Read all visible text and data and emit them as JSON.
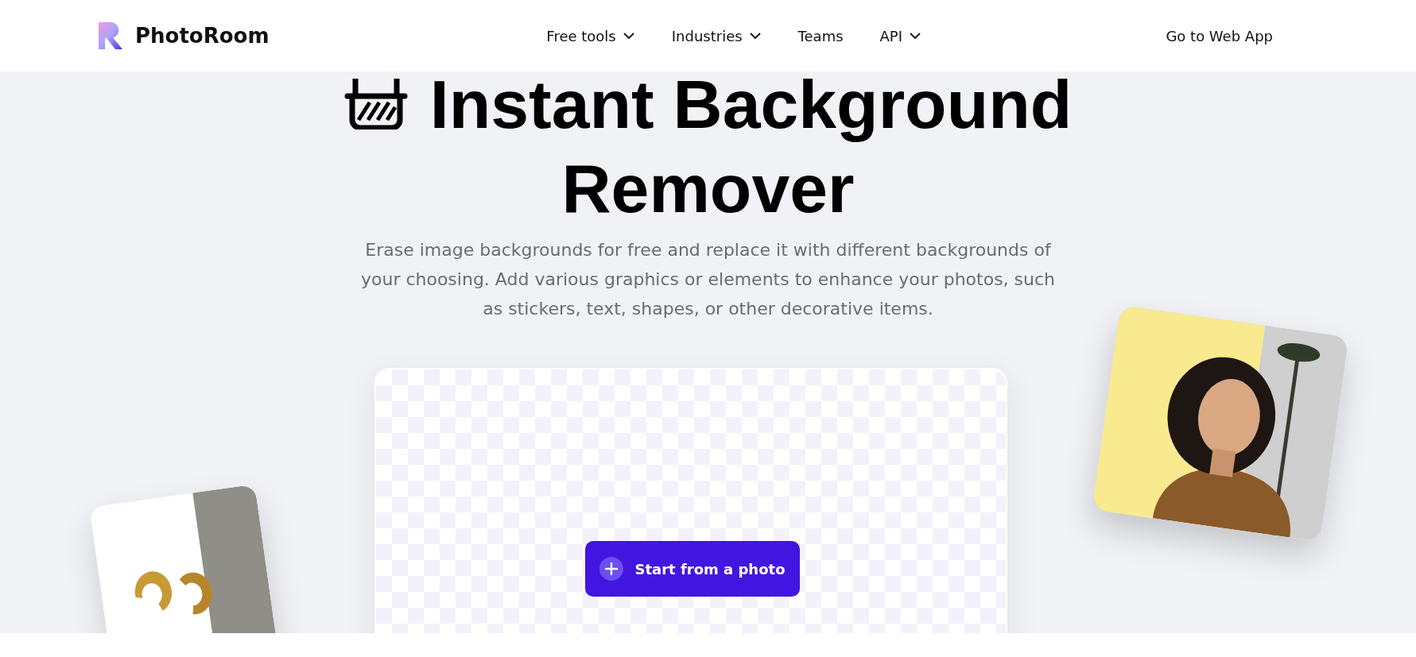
{
  "header": {
    "brand": "PhotoRoom",
    "nav": [
      {
        "label": "Free tools",
        "dropdown": true
      },
      {
        "label": "Industries",
        "dropdown": true
      },
      {
        "label": "Teams",
        "dropdown": false
      },
      {
        "label": "API",
        "dropdown": true
      }
    ],
    "cta": "Go to Web App"
  },
  "hero": {
    "title_lines": [
      "Instant Background",
      "Remover"
    ],
    "description": "Erase image backgrounds for free and replace it with different backgrounds of your choosing. Add various graphics or elements to enhance your photos, such as stickers, text, shapes, or other decorative items.",
    "button": "Start from a photo"
  }
}
